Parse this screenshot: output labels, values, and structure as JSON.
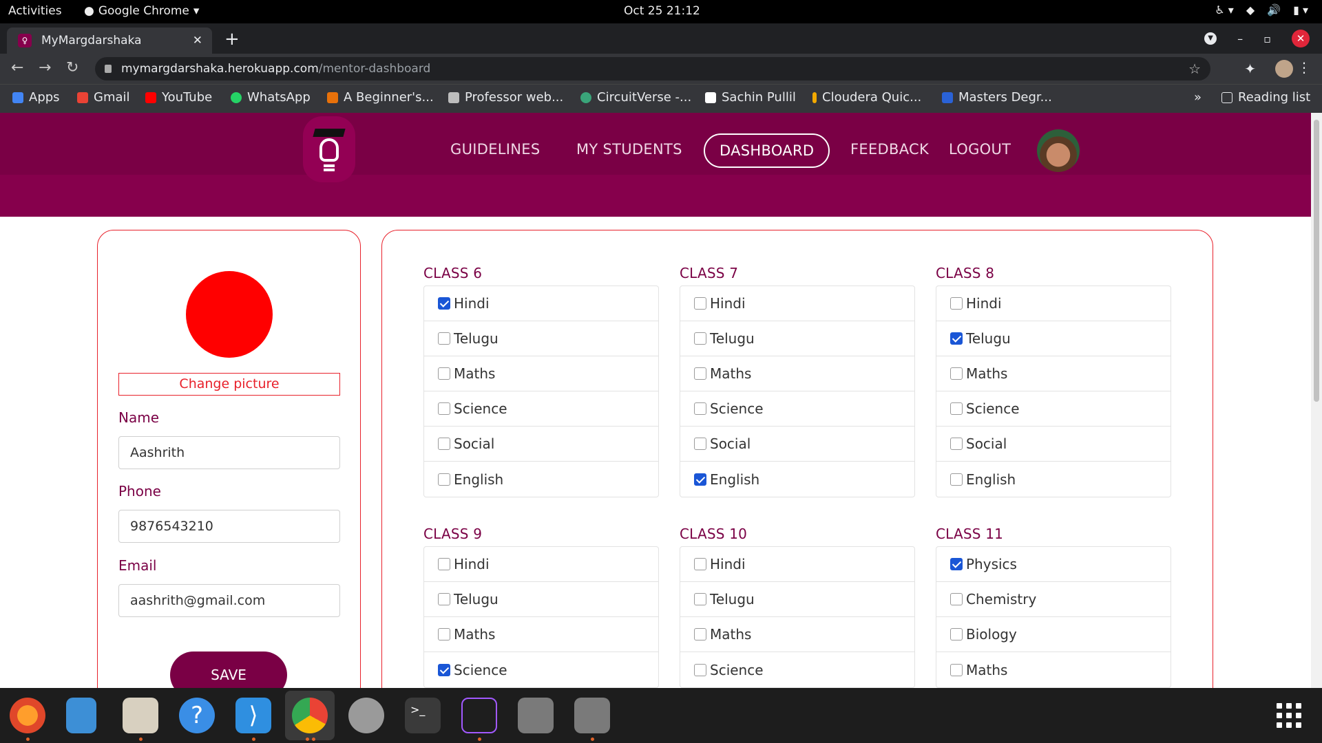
{
  "system": {
    "activities": "Activities",
    "app_name": "Google Chrome",
    "clock": "Oct 25  21:12"
  },
  "browser": {
    "tab_title": "MyMargdarshaka",
    "url_domain": "mymargdarshaka.herokuapp.com",
    "url_path": "/mentor-dashboard"
  },
  "bookmarks": [
    {
      "label": "Apps",
      "color": "#4285f4"
    },
    {
      "label": "Gmail",
      "color": "#ea4335"
    },
    {
      "label": "YouTube",
      "color": "#ff0000"
    },
    {
      "label": "WhatsApp",
      "color": "#25d366"
    },
    {
      "label": "A Beginner's...",
      "color": "#e8710a"
    },
    {
      "label": "Professor web...",
      "color": "#bdbdbd"
    },
    {
      "label": "CircuitVerse -...",
      "color": "#3aa57a"
    },
    {
      "label": "Sachin Pullil",
      "color": "#ffffff"
    },
    {
      "label": "Cloudera Quic...",
      "color": "#f2a900"
    },
    {
      "label": "Masters Degr...",
      "color": "#2a62d6"
    }
  ],
  "reading_list": "Reading list",
  "nav": {
    "guidelines": "GUIDELINES",
    "my_students": "MY STUDENTS",
    "dashboard": "DASHBOARD",
    "feedback": "FEEDBACK",
    "logout": "LOGOUT"
  },
  "profile": {
    "change_picture": "Change picture",
    "name_label": "Name",
    "name_value": "Aashrith",
    "phone_label": "Phone",
    "phone_value": "9876543210",
    "email_label": "Email",
    "email_value": "aashrith@gmail.com",
    "save": "SAVE"
  },
  "classes": [
    {
      "title": "CLASS 6",
      "subjects": [
        {
          "name": "Hindi",
          "checked": true
        },
        {
          "name": "Telugu",
          "checked": false
        },
        {
          "name": "Maths",
          "checked": false
        },
        {
          "name": "Science",
          "checked": false
        },
        {
          "name": "Social",
          "checked": false
        },
        {
          "name": "English",
          "checked": false
        }
      ]
    },
    {
      "title": "CLASS 7",
      "subjects": [
        {
          "name": "Hindi",
          "checked": false
        },
        {
          "name": "Telugu",
          "checked": false
        },
        {
          "name": "Maths",
          "checked": false
        },
        {
          "name": "Science",
          "checked": false
        },
        {
          "name": "Social",
          "checked": false
        },
        {
          "name": "English",
          "checked": true
        }
      ]
    },
    {
      "title": "CLASS 8",
      "subjects": [
        {
          "name": "Hindi",
          "checked": false
        },
        {
          "name": "Telugu",
          "checked": true
        },
        {
          "name": "Maths",
          "checked": false
        },
        {
          "name": "Science",
          "checked": false
        },
        {
          "name": "Social",
          "checked": false
        },
        {
          "name": "English",
          "checked": false
        }
      ]
    },
    {
      "title": "CLASS 9",
      "subjects": [
        {
          "name": "Hindi",
          "checked": false
        },
        {
          "name": "Telugu",
          "checked": false
        },
        {
          "name": "Maths",
          "checked": false
        },
        {
          "name": "Science",
          "checked": true
        }
      ]
    },
    {
      "title": "CLASS 10",
      "subjects": [
        {
          "name": "Hindi",
          "checked": false
        },
        {
          "name": "Telugu",
          "checked": false
        },
        {
          "name": "Maths",
          "checked": false
        },
        {
          "name": "Science",
          "checked": false
        }
      ]
    },
    {
      "title": "CLASS 11",
      "subjects": [
        {
          "name": "Physics",
          "checked": true
        },
        {
          "name": "Chemistry",
          "checked": false
        },
        {
          "name": "Biology",
          "checked": false
        },
        {
          "name": "Maths",
          "checked": false
        }
      ]
    }
  ],
  "dock": [
    {
      "name": "firefox",
      "color": "#ff7139"
    },
    {
      "name": "text-editor",
      "color": "#3d8fd6"
    },
    {
      "name": "files",
      "color": "#d8d0c0"
    },
    {
      "name": "help",
      "color": "#3a8ee6"
    },
    {
      "name": "vscode",
      "color": "#2f8fe0"
    },
    {
      "name": "chrome",
      "color": "#4285f4"
    },
    {
      "name": "settings",
      "color": "#9a9a9a"
    },
    {
      "name": "terminal",
      "color": "#3a3a3a"
    },
    {
      "name": "figma",
      "color": "#a259ff"
    },
    {
      "name": "ssd-drive",
      "color": "#7a7a7a"
    },
    {
      "name": "ssd-drive",
      "color": "#7a7a7a"
    }
  ],
  "colors": {
    "brand": "#86004c",
    "accent": "#e8202a",
    "checkbox": "#1a56d6"
  }
}
